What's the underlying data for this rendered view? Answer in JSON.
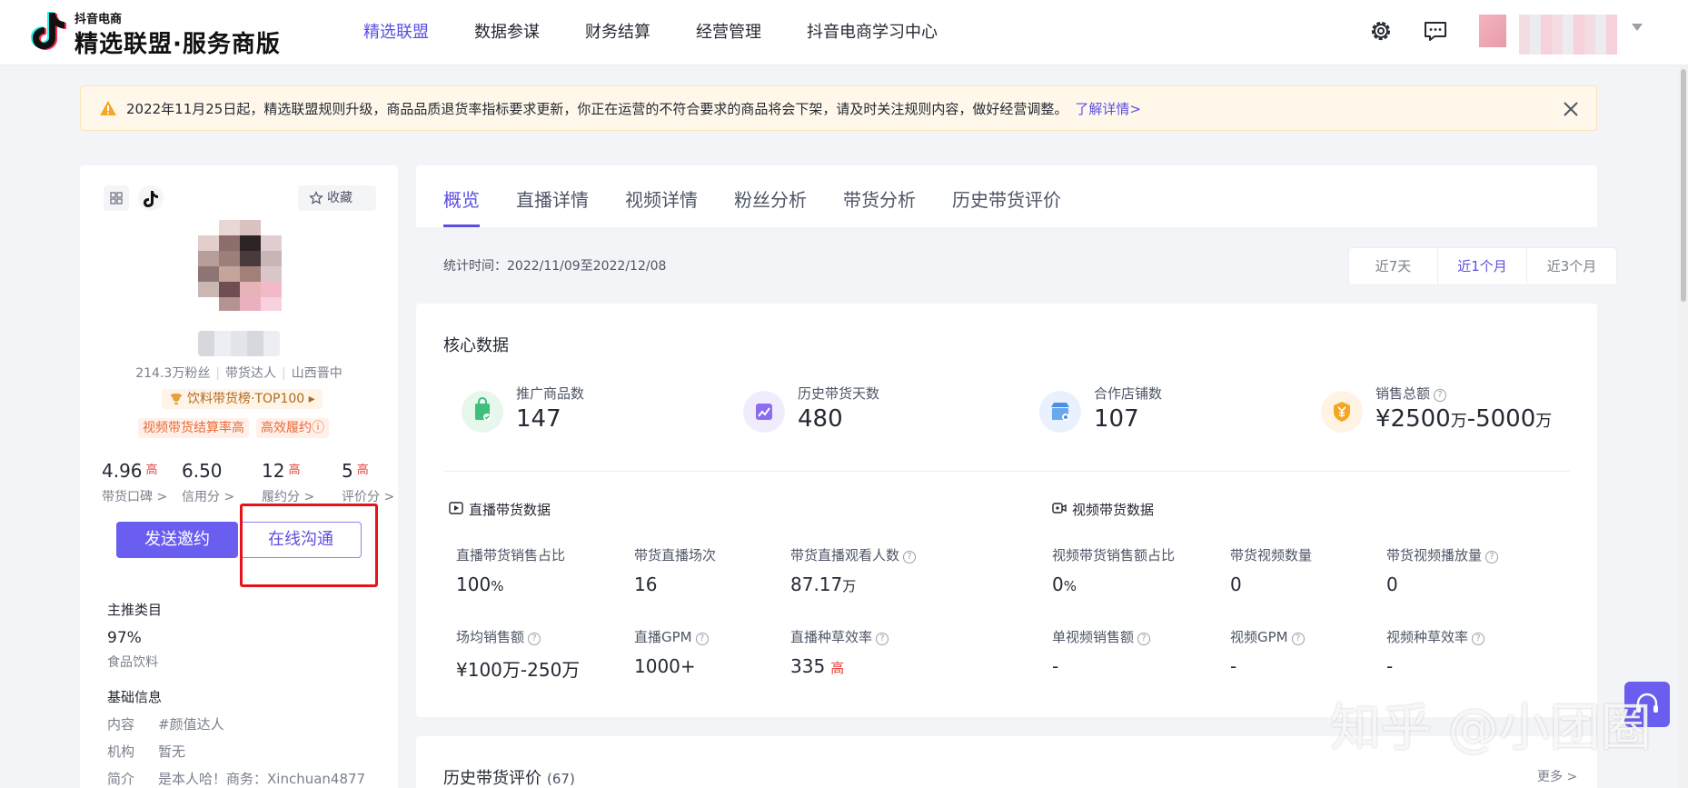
{
  "header": {
    "logo_small": "抖音电商",
    "logo_main": "精选联盟·服务商版",
    "nav": [
      "精选联盟",
      "数据参谋",
      "财务结算",
      "经营管理",
      "抖音电商学习中心"
    ],
    "active_nav": 0
  },
  "notice": {
    "text": "2022年11月25日起，精选联盟规则升级，商品品质退货率指标要求更新，你正在运营的不符合要求的商品将会下架，请及时关注规则内容，做好经营调整。",
    "link": "了解详情>"
  },
  "profile": {
    "fav_label": "收藏",
    "meta": [
      "214.3万粉丝",
      "带货达人",
      "山西晋中"
    ],
    "rank": "饮料带货榜·TOP100 ▸",
    "tags": [
      "视频带货结算率高",
      "高效履约ⓘ"
    ],
    "scores": [
      {
        "value": "4.96",
        "hi": "高",
        "label": "带货口碑 >"
      },
      {
        "value": "6.50",
        "hi": "",
        "label": "信用分 >"
      },
      {
        "value": "12",
        "hi": "高",
        "label": "履约分 >"
      },
      {
        "value": "5",
        "hi": "高",
        "label": "评价分 >"
      }
    ],
    "invite_button": "发送邀约",
    "chat_button": "在线沟通",
    "main_category_title": "主推类目",
    "main_category_pct": "97%",
    "main_category_name": "食品饮料",
    "basic_info_title": "基础信息",
    "info": [
      {
        "k": "内容",
        "v": "#颜值达人"
      },
      {
        "k": "机构",
        "v": "暂无"
      },
      {
        "k": "简介",
        "v": "是本人哈！商务：Xinchuan4877"
      }
    ]
  },
  "tabs": [
    "概览",
    "直播详情",
    "视频详情",
    "粉丝分析",
    "带货分析",
    "历史带货评价"
  ],
  "active_tab": 0,
  "stat_time": "统计时间：2022/11/09至2022/12/08",
  "ranges": [
    "近7天",
    "近1个月",
    "近3个月"
  ],
  "active_range": 1,
  "core": {
    "title": "核心数据",
    "kpis": [
      {
        "label": "推广商品数",
        "value": "147",
        "color": "#e6f7ec",
        "icon": "bag-icon"
      },
      {
        "label": "历史带货天数",
        "value": "480",
        "color": "#f1ecfd",
        "icon": "chart-icon"
      },
      {
        "label": "合作店铺数",
        "value": "107",
        "color": "#e8f1fd",
        "icon": "shop-icon"
      },
      {
        "label": "销售总额",
        "value_pre": "¥2500",
        "unit1": "万",
        "value_mid": "-5000",
        "unit2": "万",
        "color": "#fff4e3",
        "icon": "money-icon"
      }
    ],
    "live_title": "直播带货数据",
    "video_title": "视频带货数据",
    "live_metrics": [
      {
        "label": "直播带货销售占比",
        "value": "100",
        "unit": "%"
      },
      {
        "label": "带货直播场次",
        "value": "16"
      },
      {
        "label": "带货直播观看人数",
        "value": "87.17",
        "unit": "万"
      },
      {
        "label": "场均销售额",
        "value": "¥100万-250万"
      },
      {
        "label": "直播GPM",
        "value": "1000+"
      },
      {
        "label": "直播种草效率",
        "value": "335",
        "hi": "高"
      }
    ],
    "video_metrics": [
      {
        "label": "视频带货销售额占比",
        "value": "0",
        "unit": "%"
      },
      {
        "label": "带货视频数量",
        "value": "0"
      },
      {
        "label": "带货视频播放量",
        "value": "0"
      },
      {
        "label": "单视频销售额",
        "value": "-"
      },
      {
        "label": "视频GPM",
        "value": "-"
      },
      {
        "label": "视频种草效率",
        "value": "-"
      }
    ]
  },
  "history": {
    "title": "历史带货评价",
    "count": "(67)",
    "more": "更多 >"
  },
  "watermark": "知乎 @小团圈"
}
